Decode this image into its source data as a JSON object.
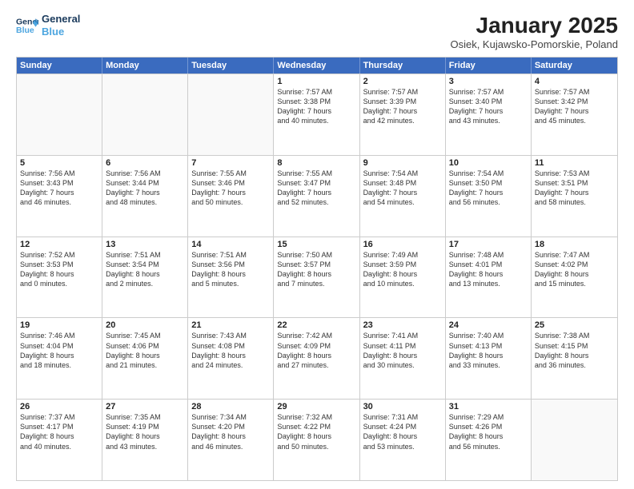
{
  "header": {
    "logo": {
      "line1": "General",
      "line2": "Blue"
    },
    "title": "January 2025",
    "subtitle": "Osiek, Kujawsko-Pomorskie, Poland"
  },
  "weekdays": [
    "Sunday",
    "Monday",
    "Tuesday",
    "Wednesday",
    "Thursday",
    "Friday",
    "Saturday"
  ],
  "rows": [
    [
      {
        "day": "",
        "text": ""
      },
      {
        "day": "",
        "text": ""
      },
      {
        "day": "",
        "text": ""
      },
      {
        "day": "1",
        "text": "Sunrise: 7:57 AM\nSunset: 3:38 PM\nDaylight: 7 hours\nand 40 minutes."
      },
      {
        "day": "2",
        "text": "Sunrise: 7:57 AM\nSunset: 3:39 PM\nDaylight: 7 hours\nand 42 minutes."
      },
      {
        "day": "3",
        "text": "Sunrise: 7:57 AM\nSunset: 3:40 PM\nDaylight: 7 hours\nand 43 minutes."
      },
      {
        "day": "4",
        "text": "Sunrise: 7:57 AM\nSunset: 3:42 PM\nDaylight: 7 hours\nand 45 minutes."
      }
    ],
    [
      {
        "day": "5",
        "text": "Sunrise: 7:56 AM\nSunset: 3:43 PM\nDaylight: 7 hours\nand 46 minutes."
      },
      {
        "day": "6",
        "text": "Sunrise: 7:56 AM\nSunset: 3:44 PM\nDaylight: 7 hours\nand 48 minutes."
      },
      {
        "day": "7",
        "text": "Sunrise: 7:55 AM\nSunset: 3:46 PM\nDaylight: 7 hours\nand 50 minutes."
      },
      {
        "day": "8",
        "text": "Sunrise: 7:55 AM\nSunset: 3:47 PM\nDaylight: 7 hours\nand 52 minutes."
      },
      {
        "day": "9",
        "text": "Sunrise: 7:54 AM\nSunset: 3:48 PM\nDaylight: 7 hours\nand 54 minutes."
      },
      {
        "day": "10",
        "text": "Sunrise: 7:54 AM\nSunset: 3:50 PM\nDaylight: 7 hours\nand 56 minutes."
      },
      {
        "day": "11",
        "text": "Sunrise: 7:53 AM\nSunset: 3:51 PM\nDaylight: 7 hours\nand 58 minutes."
      }
    ],
    [
      {
        "day": "12",
        "text": "Sunrise: 7:52 AM\nSunset: 3:53 PM\nDaylight: 8 hours\nand 0 minutes."
      },
      {
        "day": "13",
        "text": "Sunrise: 7:51 AM\nSunset: 3:54 PM\nDaylight: 8 hours\nand 2 minutes."
      },
      {
        "day": "14",
        "text": "Sunrise: 7:51 AM\nSunset: 3:56 PM\nDaylight: 8 hours\nand 5 minutes."
      },
      {
        "day": "15",
        "text": "Sunrise: 7:50 AM\nSunset: 3:57 PM\nDaylight: 8 hours\nand 7 minutes."
      },
      {
        "day": "16",
        "text": "Sunrise: 7:49 AM\nSunset: 3:59 PM\nDaylight: 8 hours\nand 10 minutes."
      },
      {
        "day": "17",
        "text": "Sunrise: 7:48 AM\nSunset: 4:01 PM\nDaylight: 8 hours\nand 13 minutes."
      },
      {
        "day": "18",
        "text": "Sunrise: 7:47 AM\nSunset: 4:02 PM\nDaylight: 8 hours\nand 15 minutes."
      }
    ],
    [
      {
        "day": "19",
        "text": "Sunrise: 7:46 AM\nSunset: 4:04 PM\nDaylight: 8 hours\nand 18 minutes."
      },
      {
        "day": "20",
        "text": "Sunrise: 7:45 AM\nSunset: 4:06 PM\nDaylight: 8 hours\nand 21 minutes."
      },
      {
        "day": "21",
        "text": "Sunrise: 7:43 AM\nSunset: 4:08 PM\nDaylight: 8 hours\nand 24 minutes."
      },
      {
        "day": "22",
        "text": "Sunrise: 7:42 AM\nSunset: 4:09 PM\nDaylight: 8 hours\nand 27 minutes."
      },
      {
        "day": "23",
        "text": "Sunrise: 7:41 AM\nSunset: 4:11 PM\nDaylight: 8 hours\nand 30 minutes."
      },
      {
        "day": "24",
        "text": "Sunrise: 7:40 AM\nSunset: 4:13 PM\nDaylight: 8 hours\nand 33 minutes."
      },
      {
        "day": "25",
        "text": "Sunrise: 7:38 AM\nSunset: 4:15 PM\nDaylight: 8 hours\nand 36 minutes."
      }
    ],
    [
      {
        "day": "26",
        "text": "Sunrise: 7:37 AM\nSunset: 4:17 PM\nDaylight: 8 hours\nand 40 minutes."
      },
      {
        "day": "27",
        "text": "Sunrise: 7:35 AM\nSunset: 4:19 PM\nDaylight: 8 hours\nand 43 minutes."
      },
      {
        "day": "28",
        "text": "Sunrise: 7:34 AM\nSunset: 4:20 PM\nDaylight: 8 hours\nand 46 minutes."
      },
      {
        "day": "29",
        "text": "Sunrise: 7:32 AM\nSunset: 4:22 PM\nDaylight: 8 hours\nand 50 minutes."
      },
      {
        "day": "30",
        "text": "Sunrise: 7:31 AM\nSunset: 4:24 PM\nDaylight: 8 hours\nand 53 minutes."
      },
      {
        "day": "31",
        "text": "Sunrise: 7:29 AM\nSunset: 4:26 PM\nDaylight: 8 hours\nand 56 minutes."
      },
      {
        "day": "",
        "text": ""
      }
    ]
  ]
}
